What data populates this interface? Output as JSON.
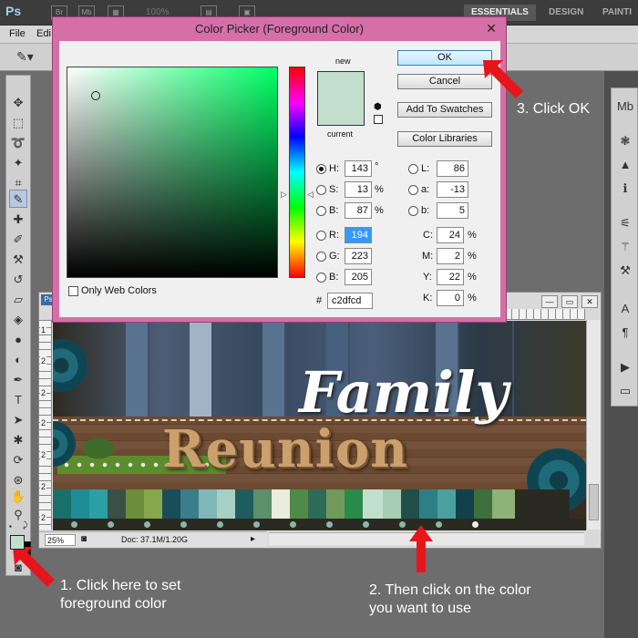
{
  "app": {
    "logo": "Ps",
    "zoom": "100%",
    "workspaces": [
      "ESSENTIALS",
      "DESIGN",
      "PAINTI"
    ]
  },
  "menu": [
    "File",
    "Edi"
  ],
  "dialog": {
    "title": "Color Picker (Foreground Color)",
    "new_label": "new",
    "current_label": "current",
    "ok": "OK",
    "cancel": "Cancel",
    "add_to_swatches": "Add To Swatches",
    "color_libraries": "Color Libraries",
    "only_web_colors": "Only Web Colors",
    "selected_color": "#c2dfcd",
    "fields": {
      "H": {
        "label": "H:",
        "value": "143",
        "unit": "°"
      },
      "S": {
        "label": "S:",
        "value": "13",
        "unit": "%"
      },
      "Bv": {
        "label": "B:",
        "value": "87",
        "unit": "%"
      },
      "R": {
        "label": "R:",
        "value": "194"
      },
      "G": {
        "label": "G:",
        "value": "223"
      },
      "Bc": {
        "label": "B:",
        "value": "205"
      },
      "L": {
        "label": "L:",
        "value": "86"
      },
      "a": {
        "label": "a:",
        "value": "-13"
      },
      "b": {
        "label": "b:",
        "value": "5"
      },
      "C": {
        "label": "C:",
        "value": "24",
        "unit": "%"
      },
      "M": {
        "label": "M:",
        "value": "2",
        "unit": "%"
      },
      "Y": {
        "label": "Y:",
        "value": "22",
        "unit": "%"
      },
      "K": {
        "label": "K:",
        "value": "0",
        "unit": "%"
      },
      "hex": {
        "label": "#",
        "value": "c2dfcd"
      }
    }
  },
  "document": {
    "tab": "Ps",
    "zoom": "25%",
    "doc_info": "Doc: 37.1M/1.20G",
    "ruler_numbers": [
      "1",
      "2",
      "2",
      "2",
      "2",
      "2",
      "2"
    ],
    "title_family": "Family",
    "title_reunion": "Reunion"
  },
  "annotations": {
    "step1": "1. Click here to set\nforeground color",
    "step2": "2. Then click on the color\nyou want to use",
    "step3": "3. Click OK"
  }
}
